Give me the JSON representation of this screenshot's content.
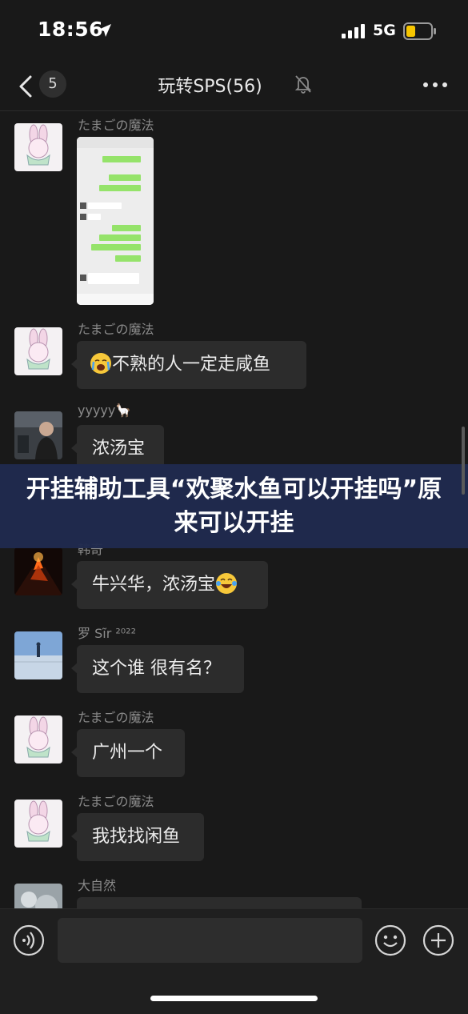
{
  "status_bar": {
    "time": "18:56",
    "network": "5G"
  },
  "nav": {
    "unread_count": "5",
    "title": "玩转SPS(56)"
  },
  "messages": [
    {
      "sender": "たまごの魔法",
      "type": "image"
    },
    {
      "sender": "たまごの魔法",
      "text": "不熟的人一定走咸鱼"
    },
    {
      "sender": "yyyyy🦙",
      "text": "浓汤宝"
    },
    {
      "sender": "韩奇",
      "text": "牛兴华，浓汤宝"
    },
    {
      "sender": "罗 Sĩr ²⁰²²",
      "text": "这个谁 很有名？"
    },
    {
      "sender": "たまごの魔法",
      "text": "广州一个"
    },
    {
      "sender": "たまごの魔法",
      "text": "我找找闲鱼"
    },
    {
      "sender": "大自然",
      "text": ""
    }
  ],
  "banner": {
    "text": "开挂辅助工具“欢聚水鱼可以开挂吗”原来可以开挂"
  },
  "icons": {
    "location": "location-arrow-icon",
    "signal": "signal-icon",
    "battery": "battery-icon",
    "back": "chevron-left-icon",
    "mute": "bell-off-icon",
    "more": "more-dots-icon",
    "voice": "voice-icon",
    "emoji": "emoji-icon",
    "plus": "plus-icon"
  },
  "colors": {
    "background": "#191919",
    "bubble": "#2c2c2c",
    "banner": "#1f2a4e",
    "battery": "#f6c500"
  }
}
